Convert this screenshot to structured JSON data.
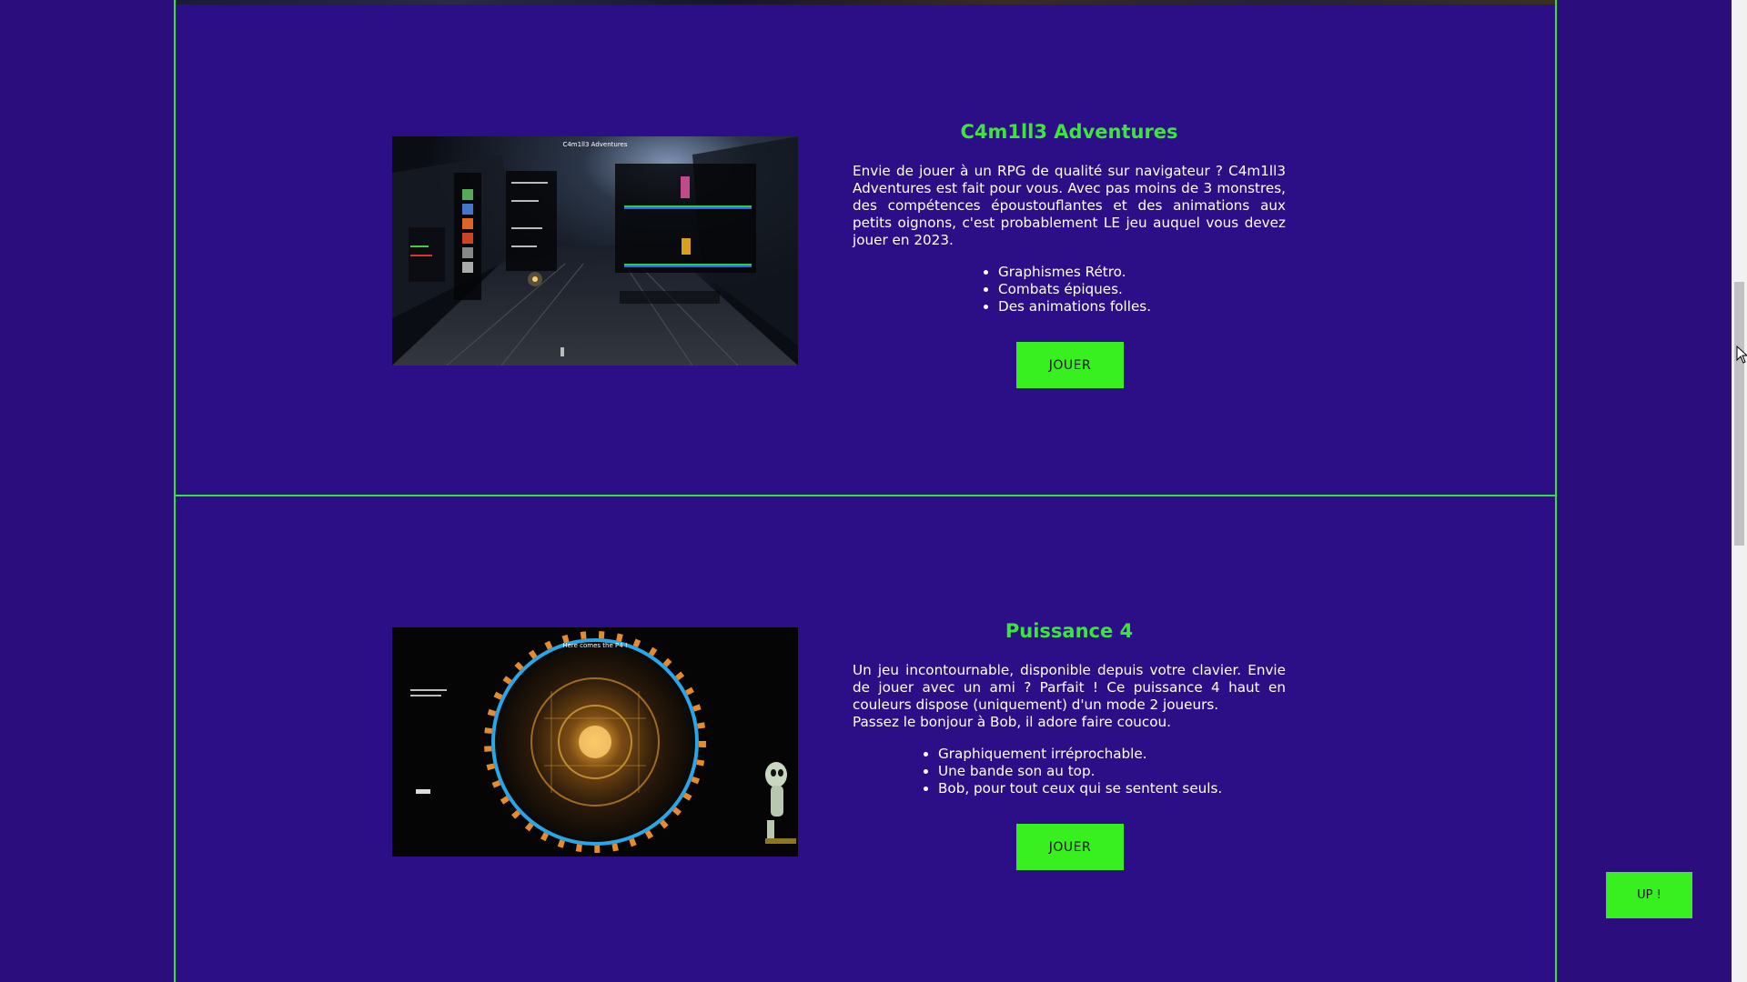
{
  "games": [
    {
      "title": "C4m1ll3 Adventures",
      "description": "Envie de jouer à un RPG de qualité sur navigateur ? C4m1ll3 Adventures est fait pour vous. Avec pas moins de 3 monstres, des compétences époustouflantes et des animations aux petits oignons, c'est probablement LE jeu auquel vous devez jouer en 2023.",
      "features": [
        "Graphismes Rétro.",
        "Combats épiques.",
        "Des animations folles."
      ],
      "button_label": "JOUER",
      "thumbnail_caption": "C4m1ll3 Adventures"
    },
    {
      "title": "Puissance 4",
      "description_lines": [
        "Un jeu incontournable, disponible depuis votre clavier. Envie de jouer avec un ami ? Parfait ! Ce puissance 4 haut en couleurs dispose (uniquement) d'un mode 2 joueurs.",
        "Passez le bonjour à Bob, il adore faire coucou."
      ],
      "features": [
        "Graphiquement irréprochable.",
        "Une bande son au top.",
        "Bob, pour tout ceux qui se sentent seuls."
      ],
      "button_label": "JOUER",
      "thumbnail_caption": "Here comes the P4 !"
    }
  ],
  "up_button_label": "UP !",
  "colors": {
    "background": "#2c0f86",
    "accent": "#38f01f",
    "title": "#3fe33f",
    "border": "#2ee82e"
  },
  "icons": {
    "cursor": "mouse-pointer-icon"
  }
}
